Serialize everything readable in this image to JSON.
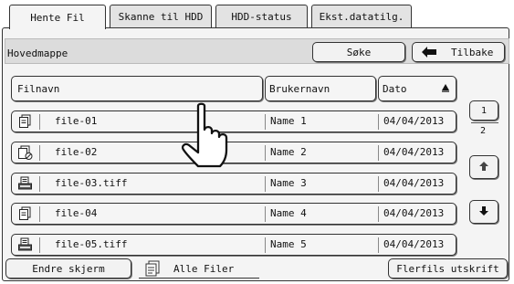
{
  "tabs": [
    {
      "label": "Hente Fil",
      "active": true
    },
    {
      "label": "Skanne til HDD",
      "active": false
    },
    {
      "label": "HDD-status",
      "active": false
    },
    {
      "label": "Ekst.datatilg.",
      "active": false
    }
  ],
  "folder": {
    "label": "Hovedmappe"
  },
  "actions": {
    "search_label": "Søke",
    "back_label": "Tilbake"
  },
  "table": {
    "headers": {
      "filename": "Filnavn",
      "username": "Brukernavn",
      "date": "Dato"
    },
    "rows": [
      {
        "icon": "document-icon",
        "filename": "file-01",
        "username": "Name 1",
        "date": "04/04/2013"
      },
      {
        "icon": "document-copy-icon",
        "filename": "file-02",
        "username": "Name 2",
        "date": "04/04/2013"
      },
      {
        "icon": "scanner-icon",
        "filename": "file-03.tiff",
        "username": "Name 3",
        "date": "04/04/2013"
      },
      {
        "icon": "document-icon",
        "filename": "file-04",
        "username": "Name 4",
        "date": "04/04/2013"
      },
      {
        "icon": "scanner-icon",
        "filename": "file-05.tiff",
        "username": "Name 5",
        "date": "04/04/2013"
      }
    ]
  },
  "pagination": {
    "current": "1",
    "total": "2"
  },
  "footer": {
    "change_screen": "Endre skjerm",
    "all_files": "Alle Filer",
    "batch_print": "Flerfils utskrift"
  }
}
